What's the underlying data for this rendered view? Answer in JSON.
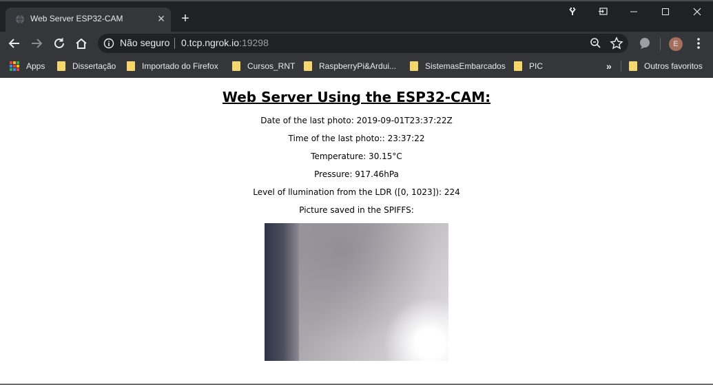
{
  "browser": {
    "tab": {
      "title": "Web Server ESP32-CAM"
    },
    "omnibox": {
      "security_label": "Não seguro",
      "url_host": "0.tcp.ngrok.io",
      "url_port": ":19298"
    },
    "profile_initial": "E",
    "bookmarks": {
      "apps_label": "Apps",
      "items": [
        "Dissertação",
        "Importado do Firefox",
        "Cursos_RNT",
        "RaspberryPi&Ardui...",
        "SistemasEmbarcados",
        "PIC"
      ],
      "overflow_label": "»",
      "other_label": "Outros favoritos"
    }
  },
  "page": {
    "title": "Web Server Using the ESP32-CAM:",
    "lines": [
      "Date of the last photo: 2019-09-01T23:37:22Z",
      "Time of the last photo:: 23:37:22",
      "Temperature: 30.15°C",
      "Pressure: 917.46hPa",
      "Level of llumination from the LDR ([0, 1023]): 224",
      "Picture saved in the SPIFFS:"
    ]
  }
}
